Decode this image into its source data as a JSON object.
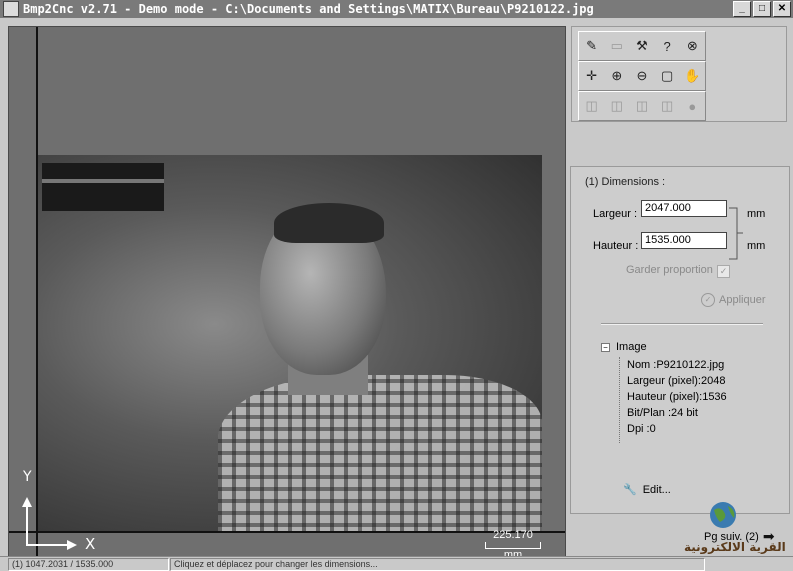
{
  "window": {
    "title": "Bmp2Cnc v2.71 - Demo mode - C:\\Documents and Settings\\MATIX\\Bureau\\P9210122.jpg",
    "buttons": [
      "_",
      "□",
      "✕"
    ]
  },
  "canvas": {
    "axis_y": "Y",
    "axis_x": "X",
    "scale_value": "225.170",
    "scale_unit": "mm"
  },
  "toolbar": {
    "row1": [
      "open-icon",
      "save-icon",
      "hammer-icon",
      "help-icon",
      "close-circle-icon"
    ],
    "row2": [
      "center-icon",
      "zoom-in-icon",
      "zoom-out-icon",
      "zoom-fit-icon",
      "hand-icon"
    ],
    "row3": [
      "cube-front-icon",
      "cube-left-icon",
      "cube-right-icon",
      "cube-iso-icon",
      "sphere-icon"
    ]
  },
  "dimensions": {
    "group_label": "(1) Dimensions :",
    "width_label": "Largeur :",
    "width_value": "2047.000",
    "height_label": "Hauteur :",
    "height_value": "1535.000",
    "unit": "mm",
    "keep_ratio_label": "Garder proportion",
    "apply_label": "Appliquer"
  },
  "image_info": {
    "root_label": "Image",
    "items": [
      "Nom :P9210122.jpg",
      "Largeur (pixel):2048",
      "Hauteur (pixel):1536",
      "Bit/Plan :24 bit",
      "Dpi :0"
    ],
    "edit_label": "Edit..."
  },
  "navigation": {
    "next_page_label": "Pg suiv. (2)"
  },
  "watermark": {
    "text": "القرية الالكترونية"
  },
  "status": {
    "cell1": "(1) 1047.2031 / 1535.000",
    "cell2": "Cliquez et déplacez pour changer les dimensions..."
  }
}
